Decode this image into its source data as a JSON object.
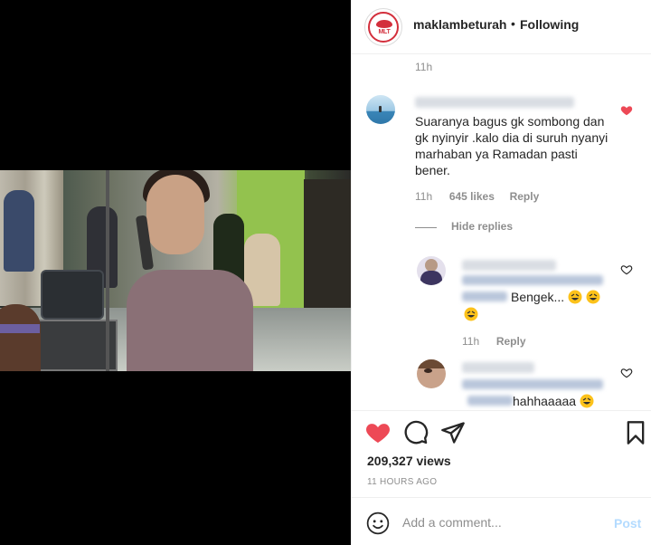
{
  "post": {
    "username": "maklambeturah",
    "separator": "•",
    "follow_status": "Following",
    "avatar_logo_text": "MLT"
  },
  "comments": {
    "top_time": "11h",
    "main": {
      "text": "Suaranya bagus gk sombong dan gk nyinyir .kalo dia di suruh nyanyi marhaban ya Ramadan pasti bener.",
      "time": "11h",
      "likes": "645 likes",
      "reply_label": "Reply",
      "liked": true
    },
    "hide_replies_label": "Hide replies",
    "replies": [
      {
        "text": "Bengek...",
        "time": "11h",
        "reply_label": "Reply",
        "emoji": "rolling-on-floor-laughing"
      },
      {
        "text": "hahhaaaaa",
        "emoji": "rolling-on-floor-laughing"
      }
    ]
  },
  "actions": {
    "views": "209,327 views",
    "posted_ago": "11 HOURS AGO",
    "like_icon": "heart-filled-icon",
    "comment_icon": "comment-bubble-icon",
    "share_icon": "paper-plane-icon",
    "save_icon": "bookmark-icon"
  },
  "add_comment": {
    "placeholder": "Add a comment...",
    "post_label": "Post"
  },
  "colors": {
    "like_red": "#ed4956",
    "muted_text": "#8e8e8e",
    "post_disabled": "#b3dbff",
    "brand_red": "#d32f3c"
  }
}
